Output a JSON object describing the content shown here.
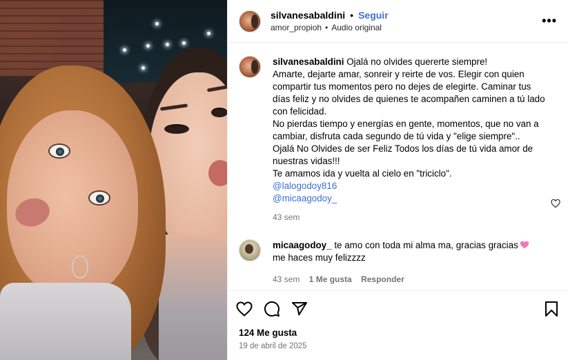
{
  "post": {
    "username": "silvanesabaldini",
    "follow_label": "Seguir",
    "audio_user": "amor_propioh",
    "audio_label": "Audio original",
    "more_label": "•••"
  },
  "caption": {
    "username": "silvanesabaldini",
    "text": "Ojalá no olvides quererte siempre!\nAmarte, dejarte amar, sonreir y reirte de vos. Elegir con quien compartir tus momentos pero no dejes de elegirte. Caminar tus días feliz y no olvides de quienes te acompañen caminen a tú lado con felicidad.\nNo pierdas tiempo y energías en gente, momentos, que no van a cambiar, disfruta cada segundo de tú vida y \"elige siempre\"..\nOjalá No Olvides de ser Feliz Todos los días de tú vida amor de nuestras vidas!!!\nTe amamos ida y vuelta al cielo en \"triciclo\".",
    "mention_1": "@lalogodoy816",
    "mention_2": "@micaagodoy_",
    "time": "43 sem"
  },
  "comment": {
    "username": "micaagodoy_",
    "text": "te amo con toda mi alma ma, gracias gracias",
    "text_2": "me haces muy felizzzz",
    "time": "43 sem",
    "likes": "1 Me gusta",
    "reply_label": "Responder"
  },
  "footer": {
    "likes": "124 Me gusta",
    "date": "19 de abril de 2025"
  },
  "icons": {
    "like": "heart-icon",
    "comment": "comment-icon",
    "share": "share-icon",
    "save": "bookmark-icon",
    "comment_like": "heart-small-icon",
    "emoji": "pink-heart-emoji"
  },
  "colors": {
    "link": "#3d6fd8",
    "muted": "#737373",
    "emoji_heart": "#f277b5"
  }
}
